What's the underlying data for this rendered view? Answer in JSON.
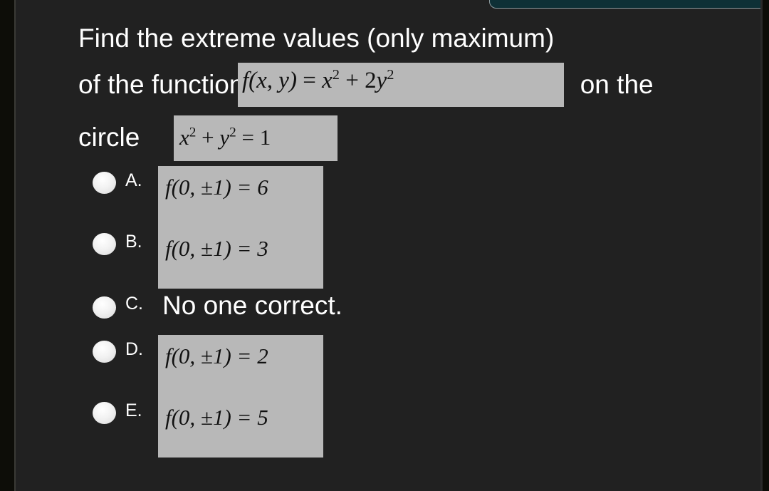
{
  "question": {
    "line1": "Find the extreme values (only maximum)",
    "line2_before": "of the function",
    "line2_after": "on the",
    "line3_before": "circle",
    "line3_after": ".",
    "function_formula": {
      "lhs": "f(x, y)",
      "eq": "=",
      "term1_base": "x",
      "term1_exp": "2",
      "plus": "+",
      "term2_coef": "2",
      "term2_base": "y",
      "term2_exp": "2"
    },
    "circle_formula": {
      "term1_base": "x",
      "term1_exp": "2",
      "plus": "+",
      "term2_base": "y",
      "term2_exp": "2",
      "eq": "=",
      "rhs": "1"
    }
  },
  "options": [
    {
      "letter": "A.",
      "kind": "math",
      "text": "f(0, ±1) = 6"
    },
    {
      "letter": "B.",
      "kind": "math",
      "text": "f(0, ±1) = 3"
    },
    {
      "letter": "C.",
      "kind": "plain",
      "text": "No one correct."
    },
    {
      "letter": "D.",
      "kind": "math",
      "text": "f(0, ±1) = 2"
    },
    {
      "letter": "E.",
      "kind": "math",
      "text": "f(0, ±1) = 5"
    }
  ],
  "colors": {
    "background": "#212121",
    "formula_plate": "#b8b8b8",
    "text": "#ffffff",
    "top_card": "#0e3036"
  }
}
